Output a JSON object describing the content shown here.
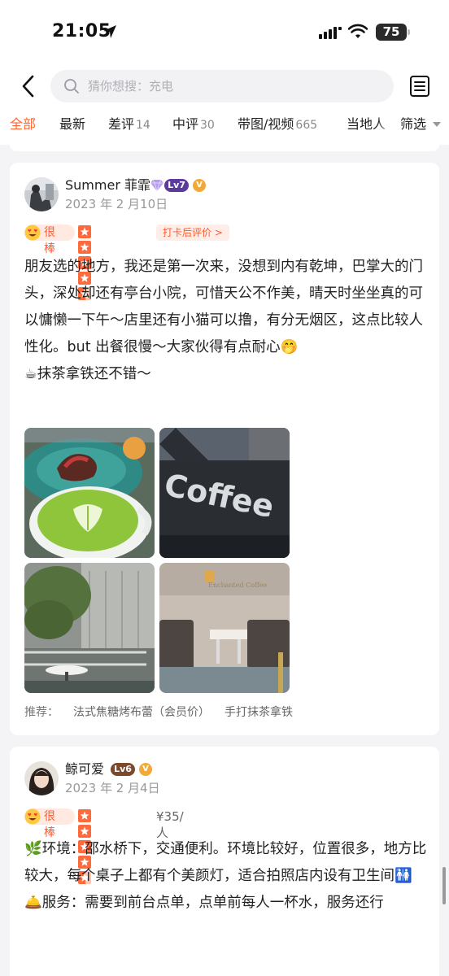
{
  "status_bar": {
    "time": "21:05",
    "battery": "75"
  },
  "search": {
    "placeholder": "猜你想搜：充电"
  },
  "tabs": [
    {
      "label": "全部",
      "count": ""
    },
    {
      "label": "最新",
      "count": ""
    },
    {
      "label": "差评",
      "count": "14"
    },
    {
      "label": "中评",
      "count": "30"
    },
    {
      "label": "带图/视频",
      "count": "665"
    },
    {
      "label": "当地人",
      "count": ""
    }
  ],
  "filter": {
    "label": "筛选"
  },
  "reviews": [
    {
      "user": "Summer 菲霏",
      "level": "Lv7",
      "date": "2023 年 2 月10日",
      "rating_word": "很棒",
      "stars": 4.5,
      "tag": "打卡后评价 >",
      "paragraphs": [
        "朋友选的地方，我还是第一次来，没想到内有乾坤，巴掌大的门头，深处却还有亭台小院，可惜天公不作美，晴天时坐坐真的可以慵懒一下午～店里还有小猫可以撸，有分无烟区，这点比较人性化。but 出餐很慢～大家伙得有点耐心🤭",
        "☕抹茶拿铁还不错～"
      ],
      "recommend_label": "推荐：",
      "recommend_items": [
        "法式焦糖烤布蕾（会员价）",
        "手打抹茶拿铁"
      ]
    },
    {
      "user": "鲸可爱",
      "level": "Lv6",
      "date": "2023 年 2 月4日",
      "rating_word": "很棒",
      "stars": 4.5,
      "price": "¥35/人",
      "paragraphs": [
        "🌿环境：邵水桥下，交通便利。环境比较好，位置很多，地方比较大，每个桌子上都有个美颜灯，适合拍照店内设有卫生间🚻",
        "🛎️服务：需要到前台点单，点单前每人一杯水，服务还行"
      ]
    }
  ]
}
